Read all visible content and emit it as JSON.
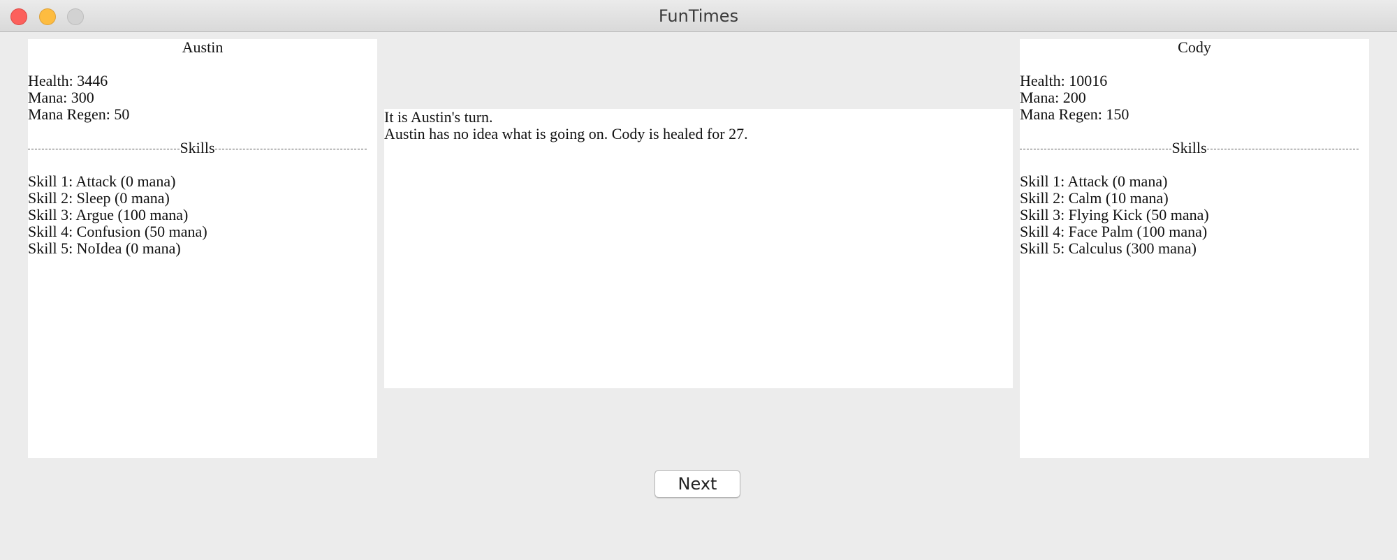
{
  "window": {
    "title": "FunTimes"
  },
  "left_player": {
    "name": "Austin",
    "health": "Health: 3446",
    "mana": "Mana: 300",
    "mana_regen": "Mana Regen: 50",
    "skills_header": "Skills",
    "skills": [
      "Skill 1: Attack (0 mana)",
      "Skill 2: Sleep (0 mana)",
      "Skill 3: Argue (100 mana)",
      "Skill 4: Confusion (50 mana)",
      "Skill 5: NoIdea (0 mana)"
    ]
  },
  "right_player": {
    "name": "Cody",
    "health": "Health: 10016",
    "mana": "Mana: 200",
    "mana_regen": "Mana Regen: 150",
    "skills_header": "Skills",
    "skills": [
      "Skill 1: Attack (0 mana)",
      "Skill 2: Calm (10 mana)",
      "Skill 3: Flying Kick (50 mana)",
      "Skill 4: Face Palm (100 mana)",
      "Skill 5: Calculus (300 mana)"
    ]
  },
  "log": {
    "lines": [
      "It is Austin's turn.",
      "Austin has no idea what is going on. Cody is healed for 27."
    ]
  },
  "controls": {
    "next_label": "Next"
  }
}
